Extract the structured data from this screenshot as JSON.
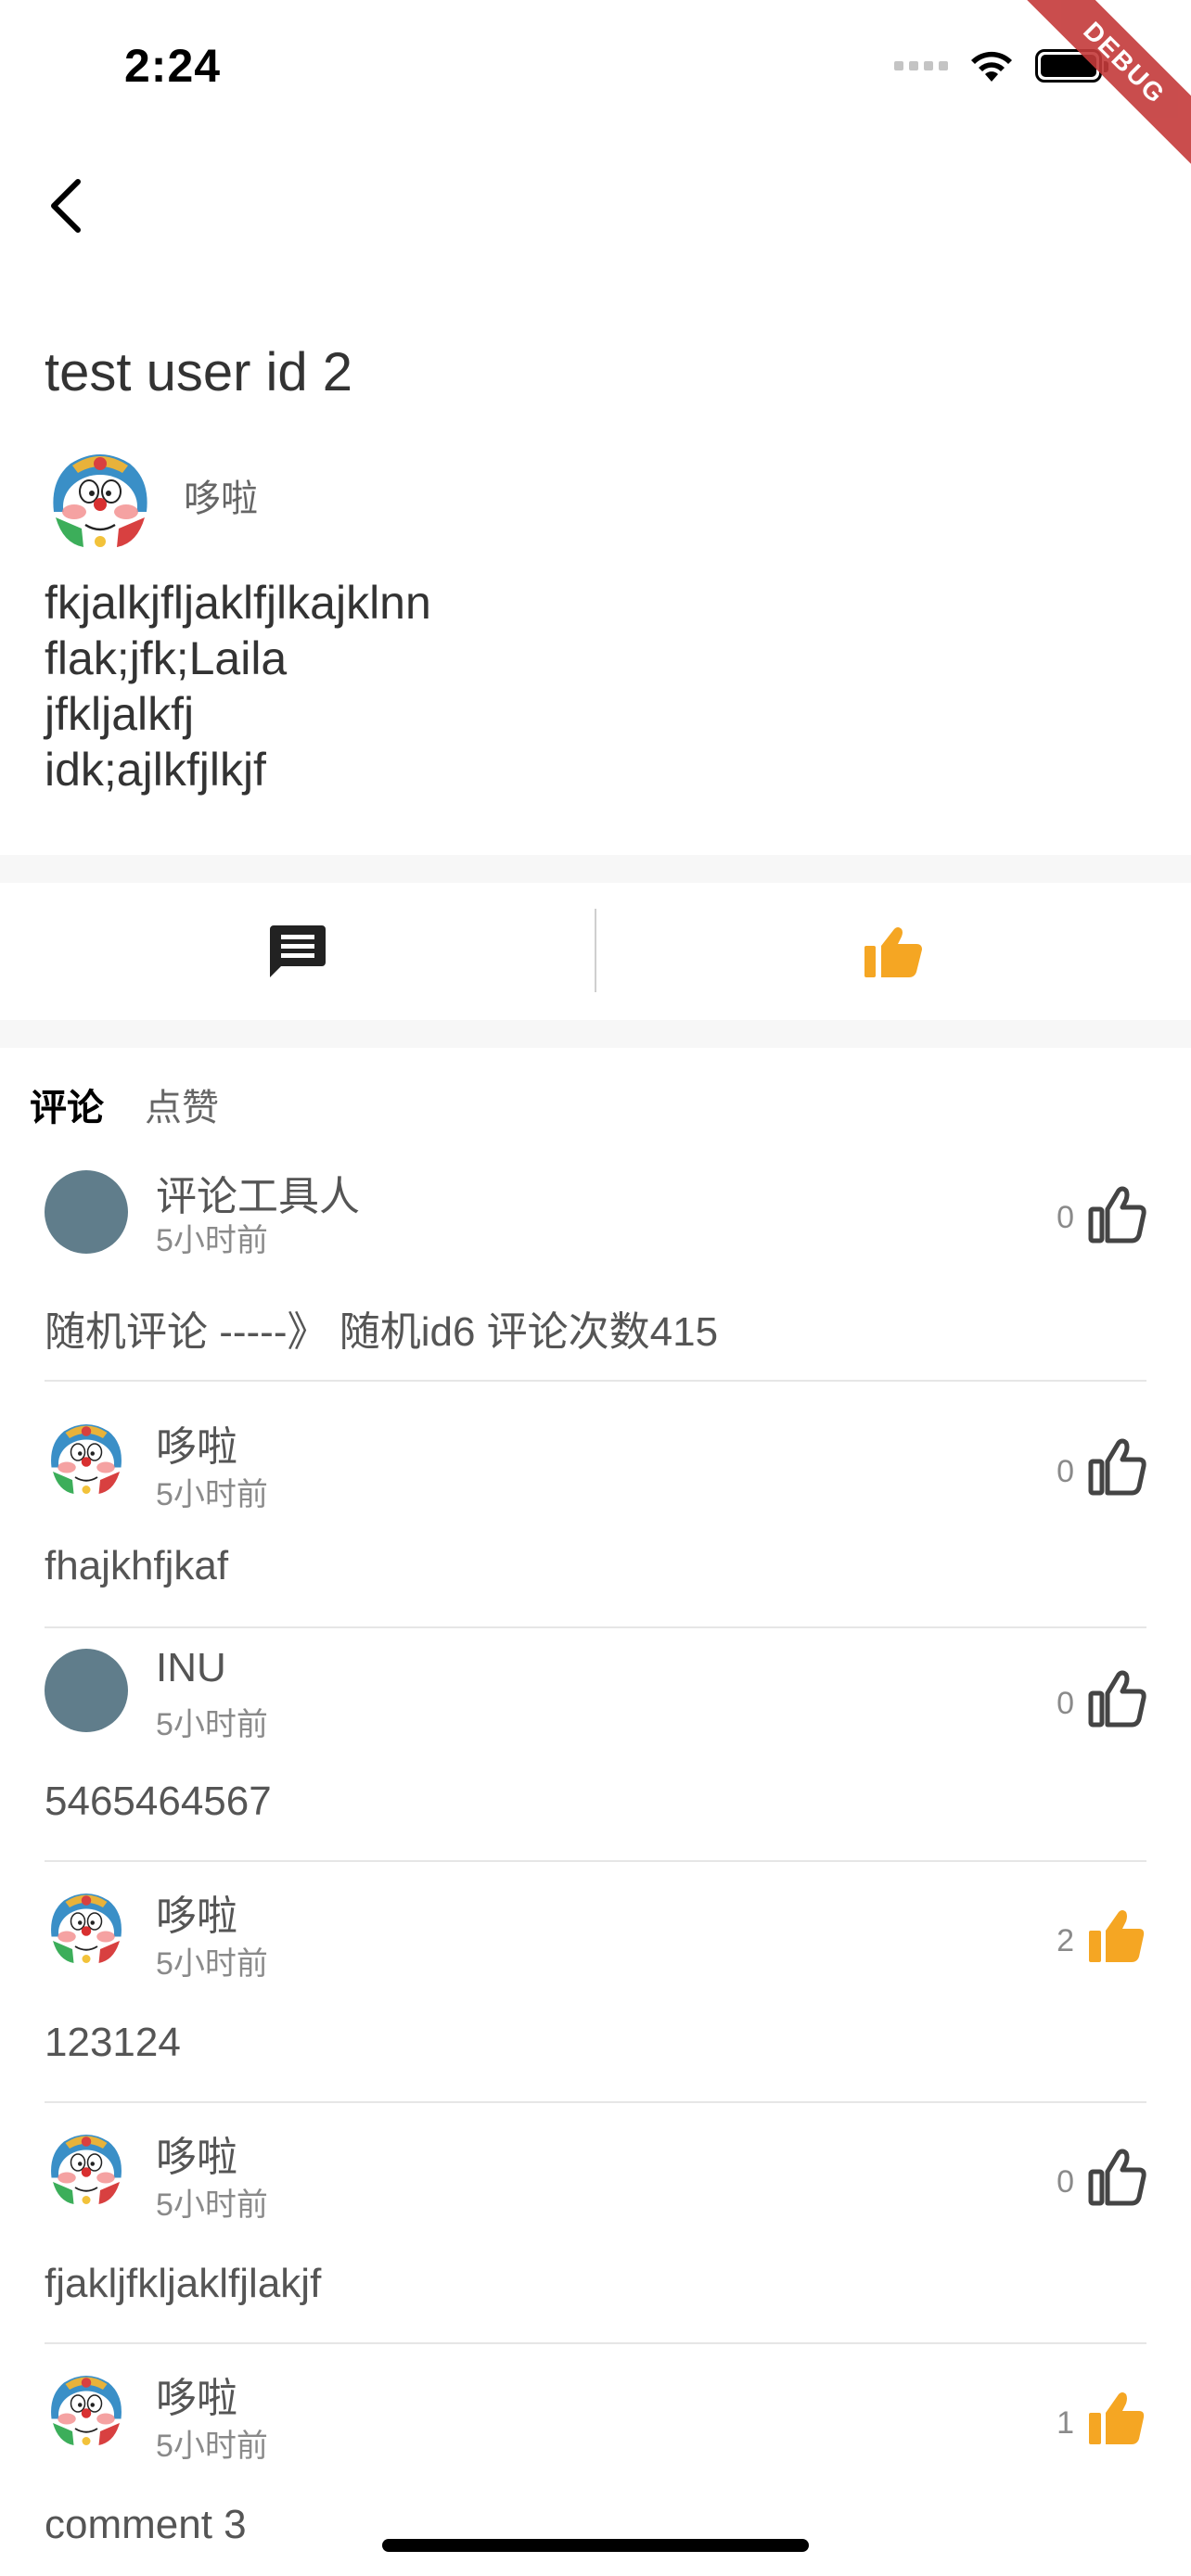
{
  "status_bar": {
    "time": "2:24"
  },
  "debug_banner": "DEBUG",
  "post": {
    "title": "test user id 2",
    "author": "哆啦",
    "body_lines": [
      "fkjalkjfljaklfjlkajklnn",
      "flak;jfk;Laila",
      "jfkljalkfj",
      "idk;ajlkfjlkjf"
    ]
  },
  "actions": {
    "comment_icon": "comment-icon",
    "like_icon": "thumb-up-icon",
    "like_color": "#F5A623"
  },
  "tabs": [
    {
      "label": "评论",
      "active": true
    },
    {
      "label": "点赞",
      "active": false
    }
  ],
  "comments": [
    {
      "avatar": "plain",
      "name": "评论工具人",
      "time": "5小时前",
      "likes": "0",
      "liked": false,
      "text": "随机评论 -----》 随机id6 评论次数415"
    },
    {
      "avatar": "doraemon",
      "name": "哆啦",
      "time": "5小时前",
      "likes": "0",
      "liked": false,
      "text": "fhajkhfjkaf"
    },
    {
      "avatar": "plain",
      "name": "INU",
      "time": "5小时前",
      "likes": "0",
      "liked": false,
      "text": "5465464567"
    },
    {
      "avatar": "doraemon",
      "name": "哆啦",
      "time": "5小时前",
      "likes": "2",
      "liked": true,
      "text": "123124"
    },
    {
      "avatar": "doraemon",
      "name": "哆啦",
      "time": "5小时前",
      "likes": "0",
      "liked": false,
      "text": "fjakljfkljaklfjlakjf"
    },
    {
      "avatar": "doraemon",
      "name": "哆啦",
      "time": "5小时前",
      "likes": "1",
      "liked": true,
      "text": "comment 3"
    }
  ],
  "colors": {
    "accent": "#F5A623",
    "avatar_plain": "#607D8B"
  }
}
